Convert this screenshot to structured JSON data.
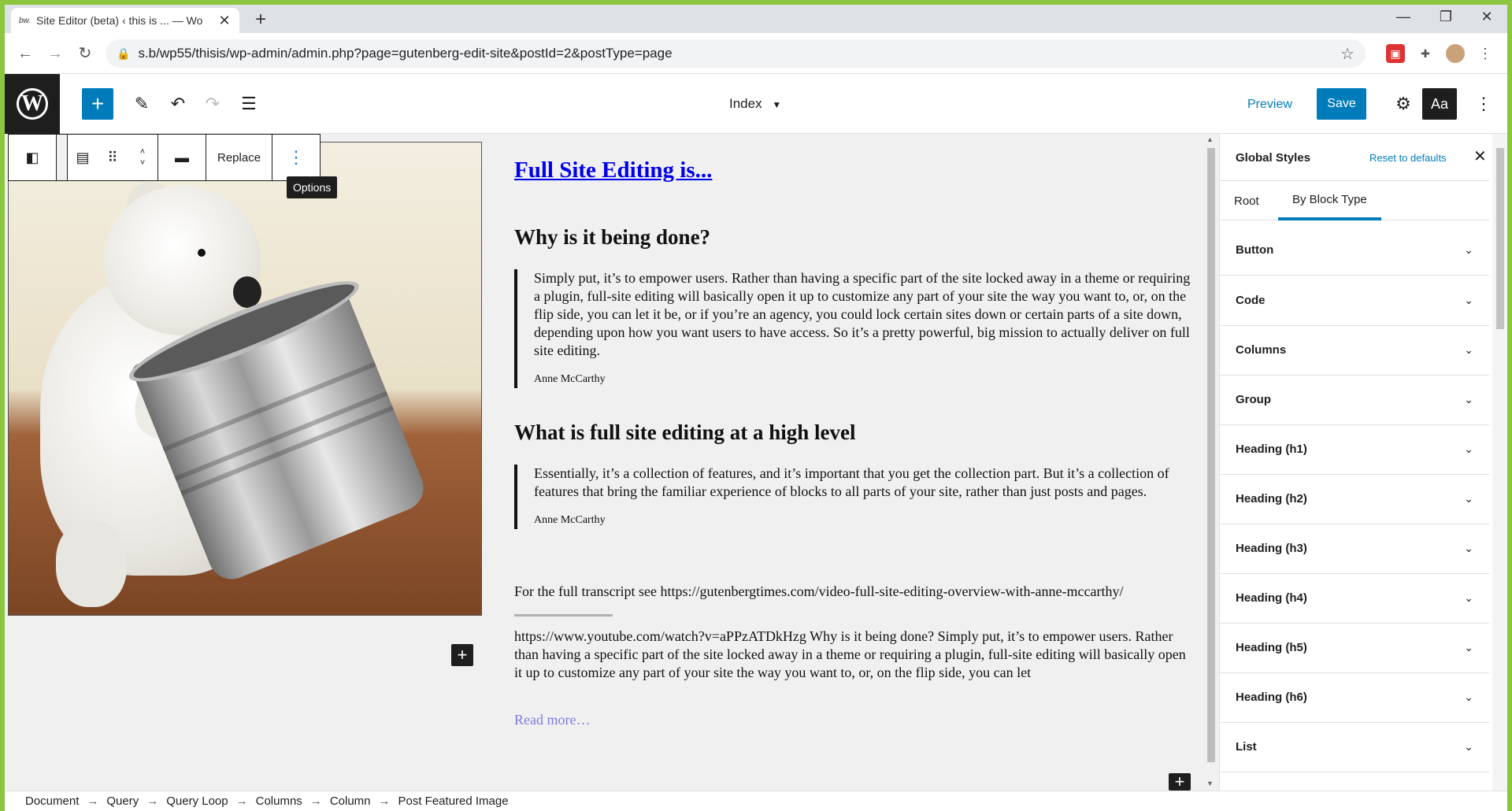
{
  "browser": {
    "tab_title": "Site Editor (beta) ‹ this is ... — Wo",
    "favicon": "bw.",
    "url": "s.b/wp55/thisis/wp-admin/admin.php?page=gutenberg-edit-site&postId=2&postType=page"
  },
  "header": {
    "doc_title": "Index",
    "preview_label": "Preview",
    "save_label": "Save",
    "styles_label": "Aa",
    "add_label": "+"
  },
  "block_toolbar": {
    "replace_label": "Replace",
    "tooltip": "Options"
  },
  "content": {
    "post_title": "Full Site Editing is...",
    "heading1": "Why is it being done?",
    "quote1": "Simply put, it’s to empower users. Rather than having a specific part of the site locked away in a theme or requiring a plugin, full-site editing will basically open it up to customize any part of your site the way you want to, or, on the flip side, you can let it be, or if you’re an agency, you could lock certain sites down or certain parts of a site down, depending upon how you want users to have access. So it’s a pretty powerful, big mission to actually deliver on full site editing.",
    "cite1": "Anne McCarthy",
    "heading2": "What is full site editing at a high level",
    "quote2": "Essentially, it’s a collection of features, and it’s important that you get the collection part. But it’s a collection of features that bring the familiar experience of blocks to all parts of your site, rather than just posts and pages.",
    "cite2": "Anne McCarthy",
    "transcript": "For the full transcript see https://gutenbergtimes.com/video-full-site-editing-overview-with-anne-mccarthy/",
    "excerpt": "https://www.youtube.com/watch?v=aPPzATDkHzg Why is it being done? Simply put, it’s to empower users. Rather than having a specific part of the site locked away in a theme or requiring a plugin, full-site editing will basically open it up to customize any part of your site the way you want to, or, on the flip side, you can let",
    "read_more": "Read more…"
  },
  "sidebar": {
    "title": "Global Styles",
    "reset_label": "Reset to defaults",
    "tabs": [
      {
        "label": "Root"
      },
      {
        "label": "By Block Type"
      }
    ],
    "panels": [
      {
        "label": "Button"
      },
      {
        "label": "Code"
      },
      {
        "label": "Columns"
      },
      {
        "label": "Group"
      },
      {
        "label": "Heading (h1)"
      },
      {
        "label": "Heading (h2)"
      },
      {
        "label": "Heading (h3)"
      },
      {
        "label": "Heading (h4)"
      },
      {
        "label": "Heading (h5)"
      },
      {
        "label": "Heading (h6)"
      },
      {
        "label": "List"
      }
    ]
  },
  "breadcrumb": [
    "Document",
    "Query",
    "Query Loop",
    "Columns",
    "Column",
    "Post Featured Image"
  ],
  "colors": {
    "accent": "#007cba",
    "frame": "#8cc63f",
    "dark": "#1e1e1e"
  }
}
